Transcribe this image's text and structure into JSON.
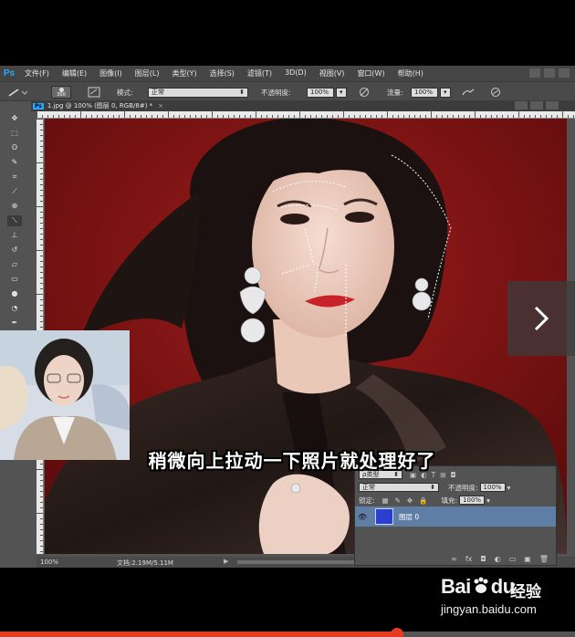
{
  "app": {
    "logo": "Ps",
    "menu": [
      "文件(F)",
      "编辑(E)",
      "图像(I)",
      "图层(L)",
      "类型(Y)",
      "选择(S)",
      "滤镜(T)",
      "3D(D)",
      "视图(V)",
      "窗口(W)",
      "帮助(H)"
    ]
  },
  "options_bar": {
    "brush_size": "300",
    "mode_label": "模式:",
    "mode_value": "正常",
    "opacity_label": "不透明度:",
    "opacity_value": "100%",
    "flow_label": "流量:",
    "flow_value": "100%"
  },
  "document": {
    "tab_title": "1.jpg @ 100% (图层 0, RGB/8#) *",
    "tab_close": "×",
    "zoom": "100%",
    "doc_info": "文档:2.19M/5.11M"
  },
  "layers_panel": {
    "filter_label": "ρ类型",
    "blend_mode": "正常",
    "opacity_label": "不透明度:",
    "opacity_value": "100%",
    "lock_label": "锁定:",
    "fill_label": "填充:",
    "fill_value": "100%",
    "layer_name": "图层 0",
    "footer_icons": [
      "∞",
      "fx",
      "◘",
      "◐",
      "▭",
      "▣",
      "🗑"
    ]
  },
  "toolbar_icons": [
    "move-tool",
    "marquee-tool",
    "lasso-tool",
    "quick-select-tool",
    "crop-tool",
    "eyedropper-tool",
    "healing-tool",
    "brush-tool",
    "clone-stamp-tool",
    "history-brush-tool",
    "eraser-tool",
    "gradient-tool",
    "blur-tool",
    "dodge-tool",
    "pen-tool",
    "type-tool",
    "path-select-tool"
  ],
  "subtitle": "稍微向上拉动一下照片就处理好了",
  "watermark": {
    "brand": "Bai",
    "brand_mid": "du",
    "jingyan": "经验",
    "url": "jingyan.baidu.com"
  },
  "video": {
    "progress": 0.69
  },
  "colors": {
    "background_red": "#7e1212",
    "accent_blue": "#29a8ff",
    "progress_red": "#e53b1f"
  }
}
